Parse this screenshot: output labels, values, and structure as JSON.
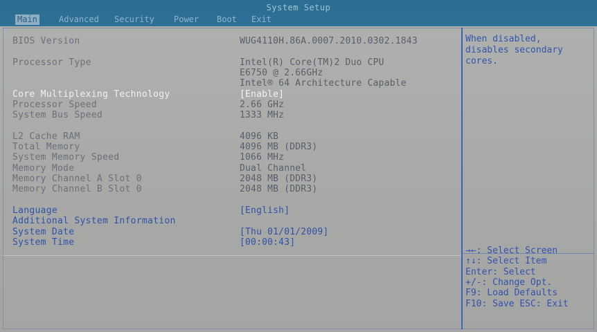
{
  "header": {
    "title": "System Setup"
  },
  "menu": [
    {
      "label": "Main",
      "active": true
    },
    {
      "label": "Advanced",
      "active": false
    },
    {
      "label": "Security",
      "active": false
    },
    {
      "label": "Power",
      "active": false
    },
    {
      "label": "Boot",
      "active": false
    },
    {
      "label": "Exit",
      "active": false
    }
  ],
  "rows": {
    "bios_version": {
      "label": "BIOS Version",
      "value": "WUG4110H.86A.0007.2010.0302.1843"
    },
    "processor_type": {
      "label": "Processor Type",
      "value1": "Intel(R) Core(TM)2 Duo CPU",
      "value2": "E6750  @ 2.66GHz",
      "value3": "Intel® 64 Architecture Capable"
    },
    "core_multiplexing": {
      "label": "Core Multiplexing Technology",
      "value": "[Enable]"
    },
    "processor_speed": {
      "label": "Processor Speed",
      "value": "2.66 GHz"
    },
    "system_bus_speed": {
      "label": "System Bus Speed",
      "value": "1333 MHz"
    },
    "l2_cache": {
      "label": "L2 Cache RAM",
      "value": "4096 KB"
    },
    "total_memory": {
      "label": "Total Memory",
      "value": "4096 MB (DDR3)"
    },
    "memory_speed": {
      "label": "System Memory Speed",
      "value": "1066 MHz"
    },
    "memory_mode": {
      "label": "Memory Mode",
      "value": "Dual Channel"
    },
    "channel_a": {
      "label": "Memory Channel A Slot 0",
      "value": "2048 MB (DDR3)"
    },
    "channel_b": {
      "label": "Memory Channel B Slot 0",
      "value": "2048 MB (DDR3)"
    },
    "language": {
      "label": "Language",
      "value": "[English]"
    },
    "additional_info": {
      "label": "Additional System Information"
    },
    "system_date": {
      "label": "System Date",
      "value": "[Thu 01/01/2009]"
    },
    "system_time": {
      "label": "System Time",
      "value": "[00:00:43]"
    }
  },
  "help": {
    "text": "When disabled,\ndisables secondary\ncores."
  },
  "keys": [
    "→←: Select Screen",
    "↑↓: Select Item",
    "Enter: Select",
    "+/-: Change Opt.",
    "F9: Load Defaults",
    "F10: Save  ESC: Exit"
  ],
  "colors": {
    "title_bar": "#2c6f92",
    "selectable_text": "#2f52a8",
    "highlight_text": "#f0f0ee",
    "screen_background": "#a9aaa8"
  }
}
